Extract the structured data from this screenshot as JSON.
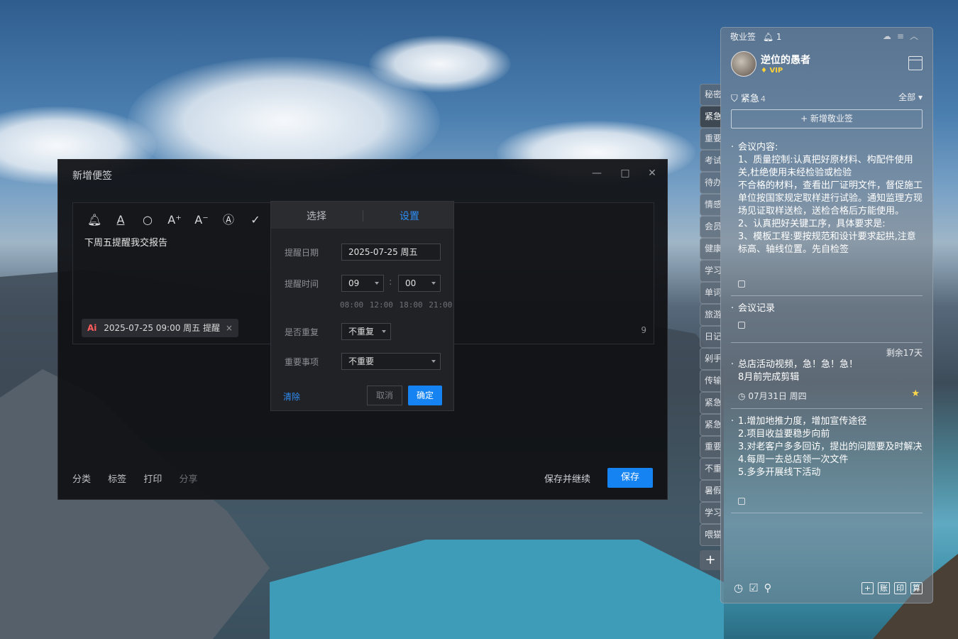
{
  "dialog": {
    "title": "新增便签",
    "content": "下周五提醒我交报告",
    "reminder_chip": {
      "ai": "Ai",
      "text": "2025-07-25 09:00 周五 提醒",
      "close": "×"
    },
    "char_count": "9",
    "bottom_links": {
      "category": "分类",
      "tag": "标签",
      "print": "打印",
      "share": "分享"
    },
    "save_continue": "保存并继续",
    "save": "保存"
  },
  "popover": {
    "tabs": {
      "select": "选择",
      "settings": "设置"
    },
    "date_label": "提醒日期",
    "date_value": "2025-07-25 周五",
    "time_label": "提醒时间",
    "hour": "09",
    "minute": "00",
    "quick_times": "08:00 12:00 18:00 21:00",
    "repeat_label": "是否重复",
    "repeat_value": "不重复",
    "importance_label": "重要事项",
    "importance_value": "不重要",
    "clear": "清除",
    "cancel": "取消",
    "ok": "确定"
  },
  "side_tabs": [
    "秘密",
    "紧急",
    "重要",
    "考试",
    "待办",
    "情感",
    "会员",
    "健康",
    "学习",
    "单词",
    "旅游",
    "日记",
    "剁手",
    "传输",
    "紧急",
    "紧急",
    "重要",
    "不重",
    "暑假",
    "学习",
    "喂猫"
  ],
  "side_add": "+",
  "panel": {
    "app_name": "敬业签",
    "notify_count": "1",
    "user_name": "逆位的愚者",
    "vip": "VIP",
    "category": "紧急",
    "category_count": "4",
    "filter": "全部",
    "new_note": "+ 新增敬业签",
    "notes": [
      "会议内容:\n1、质量控制:认真把好原材料、构配件使用关,杜绝使用未经检验或检验\n不合格的材料，查看出厂证明文件，督促施工单位按国家规定取样进行试验。通知监理方现场见证取样送检，送检合格后方能使用。\n2、认真把好关键工序，具体要求是:\n3、模板工程:要按规范和设计要求起拱,注意标高、轴线位置。先自检签",
      "会议记录",
      "总店活动视频，急！急！急！\n8月前完成剪辑",
      "1.增加地推力度，增加宣传途径\n2.项目收益要稳步向前\n3.对老客户多多回访，提出的问题要及时解决\n4.每周一去总店领一次文件\n5.多多开展线下活动"
    ],
    "remain": "剩余17天",
    "due": "07月31日 周四",
    "footer_right": [
      "+",
      "账",
      "印",
      "算"
    ]
  }
}
